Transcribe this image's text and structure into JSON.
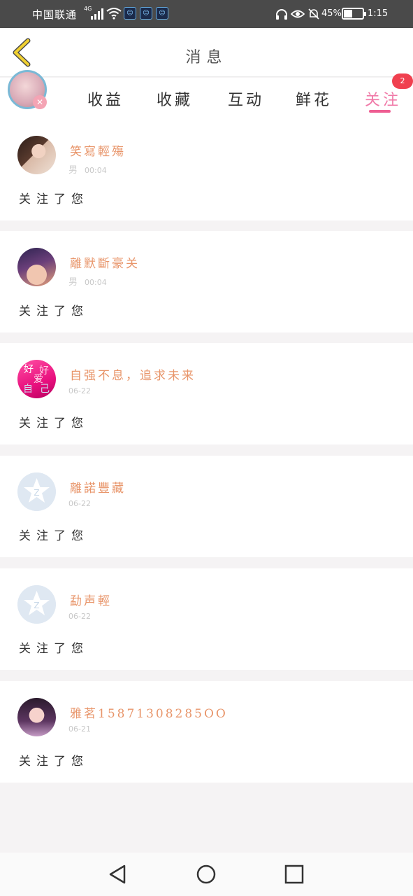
{
  "status_bar": {
    "carrier": "中国联通",
    "network": "4G",
    "app_icons": [
      "app-icon",
      "app-icon",
      "app-icon"
    ],
    "battery_percent": "45%",
    "battery_level": 0.45,
    "time": "1:15"
  },
  "header": {
    "title": "消息"
  },
  "tabs": [
    {
      "label": "收益"
    },
    {
      "label": "收藏"
    },
    {
      "label": "互动"
    },
    {
      "label": "鲜花"
    },
    {
      "label": "关注",
      "badge": "2"
    }
  ],
  "notifications": [
    {
      "name": "笑寫輕殤",
      "gender": "男",
      "time": "00:04",
      "action": "关注了您"
    },
    {
      "name": "離默斷豪关",
      "gender": "男",
      "time": "00:04",
      "action": "关注了您"
    },
    {
      "name": "自强不息，追求未来",
      "time": "06-22",
      "action": "关注了您"
    },
    {
      "name": "離諾豐藏",
      "time": "06-22",
      "action": "关注了您"
    },
    {
      "name": "勐声輕",
      "time": "06-22",
      "action": "关注了您"
    },
    {
      "name": "雅茗15871308285OO",
      "time": "06-21",
      "action": "关注了您"
    }
  ],
  "pink_avatar_text": [
    "好",
    "好",
    "爱",
    "自",
    "己"
  ],
  "colors": {
    "accent_pink": "#ee5d92",
    "name_orange": "#e8956a",
    "badge_red": "#f0404f",
    "back_yellow": "#e8c020"
  }
}
